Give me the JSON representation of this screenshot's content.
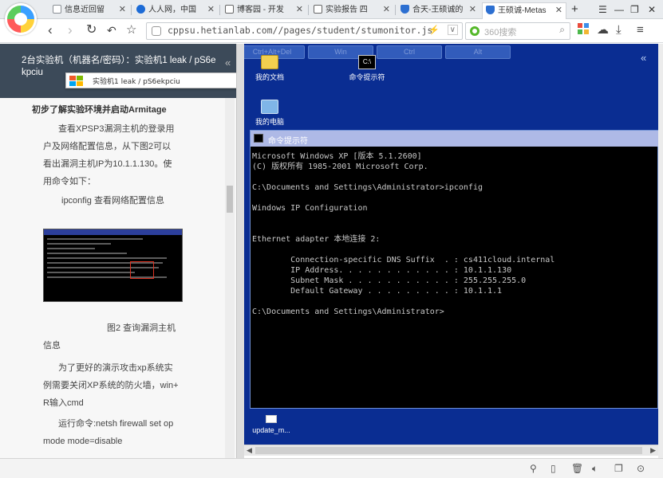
{
  "browser": {
    "tabs": [
      {
        "label": "信息近回留",
        "icon": "page-icon"
      },
      {
        "label": "人人网，中国",
        "icon": "renren-icon"
      },
      {
        "label": "博客园 - 开发",
        "icon": "cnblogs-icon"
      },
      {
        "label": "实验报告 四",
        "icon": "cnblogs-icon"
      },
      {
        "label": "合天-王硕诚的",
        "icon": "shield-icon"
      },
      {
        "label": "王硕诚-Metas",
        "icon": "shield-icon"
      }
    ],
    "new_tab": "+",
    "window_controls": {
      "menu": "☰",
      "minimize": "—",
      "restore": "❐",
      "close": "✕"
    },
    "url": "cppsu.hetianlab.com//pages/student/stumonitor.js",
    "search_placeholder": "360搜索"
  },
  "left_panel": {
    "title": "2台实验机（机器名/密码）：实验机1    leak / pS6e",
    "title_cont": "kpciu",
    "machine_select": "实验机1      leak / pS6ekpciu",
    "heading": "初步了解实验环境并启动Armitage",
    "paragraphs": [
      "查看XPSP3漏洞主机的登录用",
      "户及网络配置信息，从下图2可以",
      "看出漏洞主机IP为10.1.1.130。使",
      "用命令如下："
    ],
    "command_caption": "ipconfig 查看网络配置信息",
    "figure_caption_1": "图2 查询漏洞主机",
    "figure_caption_2": "信息",
    "para2": [
      "为了更好的演示攻击xp系统实",
      "例需要关闭XP系统的防火墙，win+",
      "R输入cmd"
    ],
    "para3": [
      "运行命令:netsh firewall set op",
      "mode mode=disable"
    ]
  },
  "remote": {
    "virtual_keys": [
      "Ctrl+Alt+Del",
      "Win",
      "Ctrl",
      "Alt"
    ],
    "desktop_icons": [
      {
        "label": "我的文档",
        "icon": "folder-icon"
      },
      {
        "label": "命令提示符",
        "icon": "cmd-icon"
      },
      {
        "label": "我的电脑",
        "icon": "computer-icon"
      }
    ],
    "cmd_title": "命令提示符",
    "cmd_lines": [
      "Microsoft Windows XP [版本 5.1.2600]",
      "(C) 版权所有 1985-2001 Microsoft Corp.",
      "",
      "C:\\Documents and Settings\\Administrator>ipconfig",
      "",
      "Windows IP Configuration",
      "",
      "",
      "Ethernet adapter 本地连接 2:",
      "",
      "        Connection-specific DNS Suffix  . : cs411cloud.internal",
      "        IP Address. . . . . . . . . . . . : 10.1.1.130",
      "        Subnet Mask . . . . . . . . . . . : 255.255.255.0",
      "        Default Gateway . . . . . . . . . : 10.1.1.1",
      "",
      "C:\\Documents and Settings\\Administrator>"
    ],
    "taskbar_item": "update_m..."
  },
  "colors": {
    "panel_header": "#3c4a59",
    "remote_bg": "#0a2d92",
    "cmd_title_bg": "#aeb9e6"
  }
}
